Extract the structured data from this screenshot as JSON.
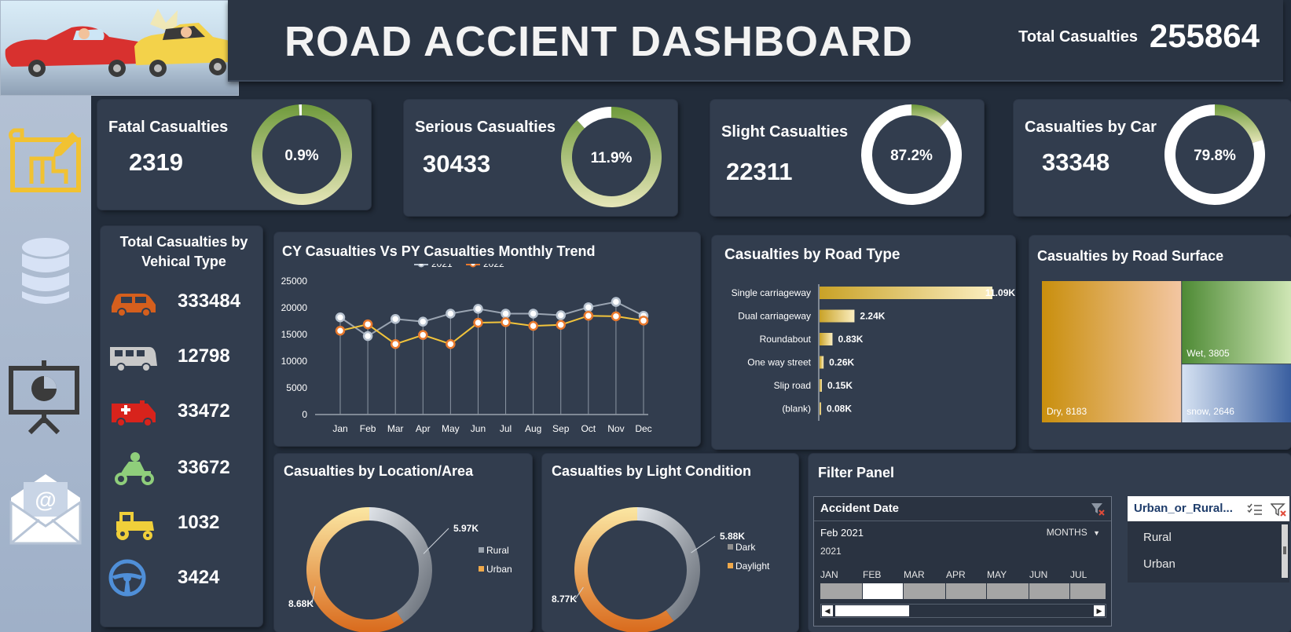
{
  "header": {
    "title": "ROAD ACCIENT DASHBOARD",
    "total_label": "Total Casualties",
    "total_value": "255864"
  },
  "sidebar": {
    "icons": [
      "blueprint-icon",
      "database-icon",
      "presentation-icon",
      "email-icon"
    ]
  },
  "kpis": [
    {
      "title": "Fatal Casualties",
      "value": "2319",
      "percent_label": "0.9%",
      "percent": 0.9
    },
    {
      "title": "Serious Casualties",
      "value": "30433",
      "percent_label": "11.9%",
      "percent": 11.9
    },
    {
      "title": "Slight Casualties",
      "value": "22311",
      "percent_label": "87.2%",
      "percent": 87.2
    },
    {
      "title": "Casualties by Car",
      "value": "33348",
      "percent_label": "79.8%",
      "percent": 79.8
    }
  ],
  "vehicle": {
    "title": "Total Casualties by Vehical Type",
    "items": [
      {
        "icon": "car-icon",
        "value": "333484",
        "color": "#d55f1d"
      },
      {
        "icon": "campervan-icon",
        "value": "12798",
        "color": "#c8c8c8"
      },
      {
        "icon": "ambulance-icon",
        "value": "33472",
        "color": "#d8231c"
      },
      {
        "icon": "motorcycle-icon",
        "value": "33672",
        "color": "#8fce7b"
      },
      {
        "icon": "tractor-icon",
        "value": "1032",
        "color": "#f0cf3a"
      },
      {
        "icon": "steering-wheel-icon",
        "value": "3424",
        "color": "#4f8fd8"
      }
    ]
  },
  "trend": {
    "title": "CY Casualties Vs PY Casualties Monthly Trend",
    "chart_data": {
      "type": "line",
      "categories": [
        "Jan",
        "Feb",
        "Mar",
        "Apr",
        "May",
        "Jun",
        "Jul",
        "Aug",
        "Sep",
        "Oct",
        "Nov",
        "Dec"
      ],
      "series": [
        {
          "name": "2021",
          "values": [
            18200,
            14700,
            17900,
            17400,
            18900,
            19800,
            18900,
            18900,
            18600,
            20100,
            21100,
            18500
          ],
          "color": "#b7c2cf"
        },
        {
          "name": "2022",
          "values": [
            15700,
            16900,
            13200,
            14900,
            13200,
            17200,
            17300,
            16600,
            16800,
            18500,
            18400,
            17600
          ],
          "color": "#e9792d"
        }
      ],
      "y_ticks": [
        "0",
        "5000",
        "10000",
        "15000",
        "20000",
        "25000"
      ],
      "ylim": [
        0,
        25000
      ]
    }
  },
  "road_type": {
    "title": "Casualties by Road Type",
    "chart_data": {
      "type": "bar",
      "categories": [
        "Single carriageway",
        "Dual carriageway",
        "Roundabout",
        "One way street",
        "Slip road",
        "(blank)"
      ],
      "values": [
        11090,
        2240,
        830,
        260,
        150,
        80
      ],
      "labels": [
        "11.09K",
        "2.24K",
        "0.83K",
        "0.26K",
        "0.15K",
        "0.08K"
      ]
    }
  },
  "road_surface": {
    "title": "Casualties by Road Surface",
    "chart_data": {
      "type": "treemap",
      "items": [
        {
          "label": "Dry, 8183",
          "value": 8183,
          "color": "#c98f0d"
        },
        {
          "label": "Wet, 3805",
          "value": 3805,
          "color": "#4e8a35"
        },
        {
          "label": "snow, 2646",
          "value": 2646,
          "color": "#3a5fa0"
        }
      ]
    }
  },
  "location": {
    "title": "Casualties by Location/Area",
    "chart_data": {
      "type": "pie",
      "categories": [
        "Rural",
        "Urban"
      ],
      "values": [
        5970,
        8680
      ],
      "labels": [
        "5.97K",
        "8.68K"
      ],
      "colors": [
        "#9aa3ad",
        "#f0a94a"
      ]
    }
  },
  "light": {
    "title": "Casualties by Light Condition",
    "chart_data": {
      "type": "pie",
      "categories": [
        "Dark",
        "Daylight"
      ],
      "values": [
        5880,
        8770
      ],
      "labels": [
        "5.88K",
        "8.77K"
      ],
      "colors": [
        "#8f8f8f",
        "#f0a94a"
      ]
    }
  },
  "filter": {
    "title": "Filter Panel",
    "timeline": {
      "header": "Accident Date",
      "selection": "Feb 2021",
      "level": "MONTHS",
      "year": "2021",
      "months": [
        "JAN",
        "FEB",
        "MAR",
        "APR",
        "MAY",
        "JUN",
        "JUL"
      ],
      "selected_index": 1
    },
    "slicer": {
      "header": "Urban_or_Rural...",
      "items": [
        "Rural",
        "Urban"
      ]
    }
  }
}
